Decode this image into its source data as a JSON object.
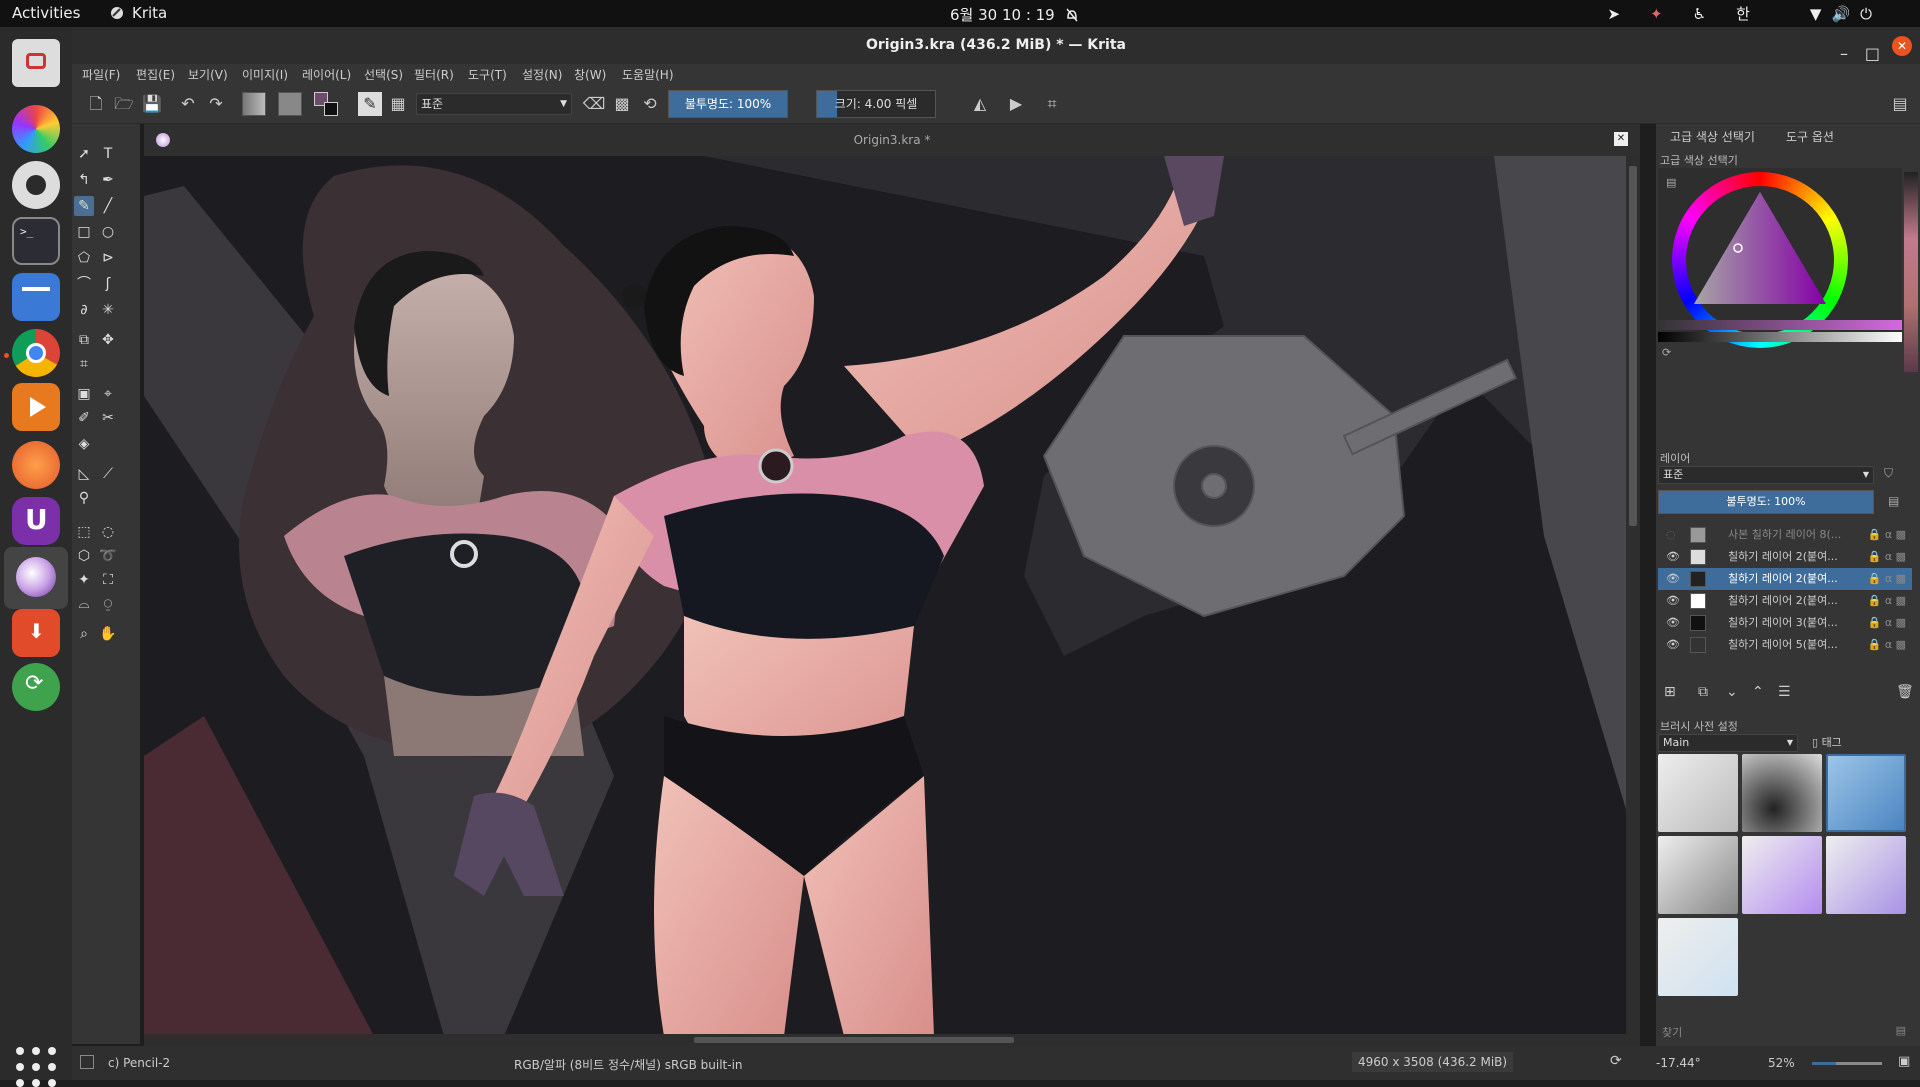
{
  "system_bar": {
    "activities": "Activities",
    "app_name": "Krita",
    "datetime": "6월 30  10 : 19",
    "ime_indicator": "한"
  },
  "window": {
    "title": "Origin3.kra (436.2 MiB)  * — Krita"
  },
  "menu": [
    "파일(F)",
    "편집(E)",
    "보기(V)",
    "이미지(I)",
    "레이어(L)",
    "선택(S)",
    "필터(R)",
    "도구(T)",
    "설정(N)",
    "창(W)",
    "도움말(H)"
  ],
  "toolbar": {
    "blend_mode": "표준",
    "opacity": "불투명도: 100%",
    "size": "크기: 4.00 픽셀"
  },
  "document_tab": "Origin3.kra *",
  "docker": {
    "tabs": [
      "고급 색상 선택기",
      "도구 옵션"
    ],
    "color_selector_title": "고급 색상 선택기",
    "layers_title": "레이어",
    "layer_blend_mode": "표준",
    "layer_opacity": "불투명도:  100%",
    "layers": [
      {
        "name": "사본 칠하기 레이어 8(...",
        "visible": false,
        "selected": false
      },
      {
        "name": "칠하기 레이어 2(붙여...",
        "visible": true,
        "selected": false
      },
      {
        "name": "칠하기 레이어 2(붙여...",
        "visible": true,
        "selected": true
      },
      {
        "name": "칠하기 레이어 2(붙여...",
        "visible": true,
        "selected": false
      },
      {
        "name": "칠하기 레이어 3(붙여...",
        "visible": true,
        "selected": false
      },
      {
        "name": "칠하기 레이어 5(붙여...",
        "visible": true,
        "selected": false
      }
    ],
    "brush_presets_title": "브러시 사전 설정",
    "brush_tag": "Main",
    "tag_label": "태그",
    "search_label": "찾기"
  },
  "statusbar": {
    "brush_name": "c) Pencil-2",
    "color_space": "RGB/알파 (8비트 정수/채널)  sRGB built-in",
    "image_size": "4960 x 3508 (436.2 MiB)",
    "rotation": "-17.44°",
    "zoom": "52%"
  },
  "colors": {
    "accent": "#3e6d9c",
    "ubuntu_orange": "#e95420",
    "panel_bg": "#353535"
  }
}
